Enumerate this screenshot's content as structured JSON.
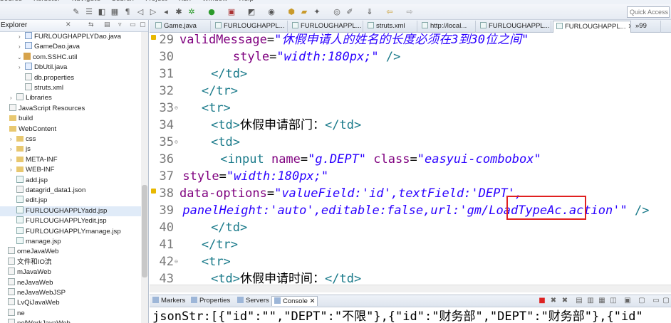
{
  "menubar": [
    "Source",
    "Refactor",
    "Navigate",
    "Search",
    "Project",
    "Run",
    "Window",
    "Help"
  ],
  "toolbar": {
    "quick_access_placeholder": "Quick Access"
  },
  "explorer": {
    "title": "Explorer",
    "items": [
      {
        "label": "FURLOUGHAPPLYDao.java",
        "type": "java",
        "indent": 12,
        "arrow": "›"
      },
      {
        "label": "GameDao.java",
        "type": "java",
        "indent": 12,
        "arrow": "›"
      },
      {
        "label": "com.SSHC.util",
        "type": "pkg",
        "indent": 10,
        "arrow": "⌄"
      },
      {
        "label": "DbUtil.java",
        "type": "java",
        "indent": 12,
        "arrow": "›"
      },
      {
        "label": "db.properties",
        "type": "file",
        "indent": 12,
        "arrow": ""
      },
      {
        "label": "struts.xml",
        "type": "xml",
        "indent": 12,
        "arrow": ""
      },
      {
        "label": "Libraries",
        "type": "lib",
        "indent": 0,
        "arrow": "›"
      },
      {
        "label": "JavaScript Resources",
        "type": "lib",
        "indent": -10,
        "arrow": ""
      },
      {
        "label": "build",
        "type": "folder",
        "indent": -10,
        "arrow": ""
      },
      {
        "label": "WebContent",
        "type": "folder",
        "indent": -10,
        "arrow": ""
      },
      {
        "label": "css",
        "type": "folder",
        "indent": 0,
        "arrow": "›"
      },
      {
        "label": "js",
        "type": "folder",
        "indent": 0,
        "arrow": "›"
      },
      {
        "label": "META-INF",
        "type": "folder",
        "indent": 0,
        "arrow": "›"
      },
      {
        "label": "WEB-INF",
        "type": "folder",
        "indent": 0,
        "arrow": "›"
      },
      {
        "label": "add.jsp",
        "type": "jsp",
        "indent": 0,
        "arrow": ""
      },
      {
        "label": "datagrid_data1.json",
        "type": "file",
        "indent": 0,
        "arrow": ""
      },
      {
        "label": "edit.jsp",
        "type": "jsp",
        "indent": 0,
        "arrow": ""
      },
      {
        "label": "FURLOUGHAPPLYadd.jsp",
        "type": "jsp",
        "indent": 0,
        "arrow": "",
        "selected": true
      },
      {
        "label": "FURLOUGHAPPLYedit.jsp",
        "type": "jsp",
        "indent": 0,
        "arrow": ""
      },
      {
        "label": "FURLOUGHAPPLYmanage.jsp",
        "type": "jsp",
        "indent": 0,
        "arrow": ""
      },
      {
        "label": "manage.jsp",
        "type": "jsp",
        "indent": 0,
        "arrow": ""
      },
      {
        "label": "omeJavaWeb",
        "type": "project",
        "indent": -12,
        "arrow": ""
      },
      {
        "label": "文件和IO流",
        "type": "project",
        "indent": -12,
        "arrow": ""
      },
      {
        "label": "mJavaWeb",
        "type": "project",
        "indent": -12,
        "arrow": ""
      },
      {
        "label": "neJavaWeb",
        "type": "project",
        "indent": -12,
        "arrow": ""
      },
      {
        "label": "neJavaWebJSP",
        "type": "project",
        "indent": -12,
        "arrow": ""
      },
      {
        "label": "LvQiJavaWeb",
        "type": "project",
        "indent": -12,
        "arrow": ""
      },
      {
        "label": "ne",
        "type": "project",
        "indent": -12,
        "arrow": ""
      },
      {
        "label": "nelWorkJavaWeb",
        "type": "project",
        "indent": -12,
        "arrow": ""
      }
    ]
  },
  "tabs": [
    {
      "label": "Game.java",
      "active": false
    },
    {
      "label": "FURLOUGHAPPL...",
      "active": false
    },
    {
      "label": "FURLOUGHAPPL...",
      "active": false
    },
    {
      "label": "struts.xml",
      "active": false
    },
    {
      "label": "http://local...",
      "active": false
    },
    {
      "label": "FURLOUGHAPPL...",
      "active": false
    },
    {
      "label": "FURLOUGHAPPL...",
      "active": true
    },
    {
      "label": "»99",
      "active": false
    }
  ],
  "code_lines": [
    {
      "num": "29",
      "warn": true,
      "fold": false,
      "indent": 0,
      "parts": [
        [
          "attr",
          "validMessage"
        ],
        [
          "plain",
          "="
        ],
        [
          "str",
          "\"休假申请人的姓名的长度必须在3到30位之间\""
        ]
      ]
    },
    {
      "num": "30",
      "warn": false,
      "fold": false,
      "indent": 17,
      "parts": [
        [
          "attr",
          "style"
        ],
        [
          "plain",
          "="
        ],
        [
          "str",
          "\"width:180px;\""
        ],
        [
          "plain",
          " "
        ],
        [
          "tag",
          "/>"
        ]
      ]
    },
    {
      "num": "31",
      "warn": false,
      "fold": false,
      "indent": 10,
      "parts": [
        [
          "tag",
          "</td>"
        ]
      ]
    },
    {
      "num": "32",
      "warn": false,
      "fold": false,
      "indent": 7,
      "parts": [
        [
          "tag",
          "</tr>"
        ]
      ]
    },
    {
      "num": "33",
      "warn": false,
      "fold": true,
      "indent": 7,
      "parts": [
        [
          "tag",
          "<tr>"
        ]
      ]
    },
    {
      "num": "34",
      "warn": false,
      "fold": false,
      "indent": 10,
      "parts": [
        [
          "tag",
          "<td>"
        ],
        [
          "plain",
          "休假申请部门："
        ],
        [
          "tag",
          "</td>"
        ]
      ]
    },
    {
      "num": "35",
      "warn": false,
      "fold": true,
      "indent": 10,
      "parts": [
        [
          "tag",
          "<td>"
        ]
      ]
    },
    {
      "num": "36",
      "warn": false,
      "fold": false,
      "indent": 13,
      "parts": [
        [
          "tag",
          "<input "
        ],
        [
          "attr",
          "name"
        ],
        [
          "plain",
          "="
        ],
        [
          "str",
          "\"g.DEPT\""
        ],
        [
          "plain",
          " "
        ],
        [
          "attr",
          "class"
        ],
        [
          "plain",
          "="
        ],
        [
          "str",
          "\"easyui-combobox\""
        ]
      ]
    },
    {
      "num": "37",
      "warn": false,
      "fold": false,
      "indent": 1,
      "parts": [
        [
          "attr",
          "style"
        ],
        [
          "plain",
          "="
        ],
        [
          "str",
          "\"width:180px;\""
        ]
      ]
    },
    {
      "num": "38",
      "warn": true,
      "fold": false,
      "indent": 0,
      "parts": [
        [
          "attr",
          "data-options"
        ],
        [
          "plain",
          "="
        ],
        [
          "str",
          "\"valueField:'id',textField:'DEPT',"
        ]
      ]
    },
    {
      "num": "39",
      "warn": false,
      "fold": false,
      "indent": 1,
      "parts": [
        [
          "str",
          "panelHeight:'auto',editable:false,url:'gm/LoadTypeAc.action'\""
        ],
        [
          "plain",
          " "
        ],
        [
          "tag",
          "/>"
        ]
      ]
    },
    {
      "num": "40",
      "warn": false,
      "fold": false,
      "indent": 10,
      "parts": [
        [
          "tag",
          "</td>"
        ]
      ]
    },
    {
      "num": "41",
      "warn": false,
      "fold": false,
      "indent": 7,
      "parts": [
        [
          "tag",
          "</tr>"
        ]
      ]
    },
    {
      "num": "42",
      "warn": false,
      "fold": true,
      "indent": 7,
      "parts": [
        [
          "tag",
          "<tr>"
        ]
      ]
    },
    {
      "num": "43",
      "warn": false,
      "fold": false,
      "indent": 10,
      "parts": [
        [
          "tag",
          "<td>"
        ],
        [
          "plain",
          "休假申请时间："
        ],
        [
          "tag",
          "</td>"
        ]
      ]
    }
  ],
  "console": {
    "tabs": [
      "Markers",
      "Properties",
      "Servers",
      "Console"
    ],
    "output": "jsonStr:[{\"id\":\"\",\"DEPT\":\"不限\"},{\"id\":\"财务部\",\"DEPT\":\"财务部\"},{\"id\""
  },
  "colors": {
    "tag": "#1a7a8a",
    "attribute": "#7f007f",
    "string": "#2a00ff",
    "highlight_box": "#e02020"
  }
}
